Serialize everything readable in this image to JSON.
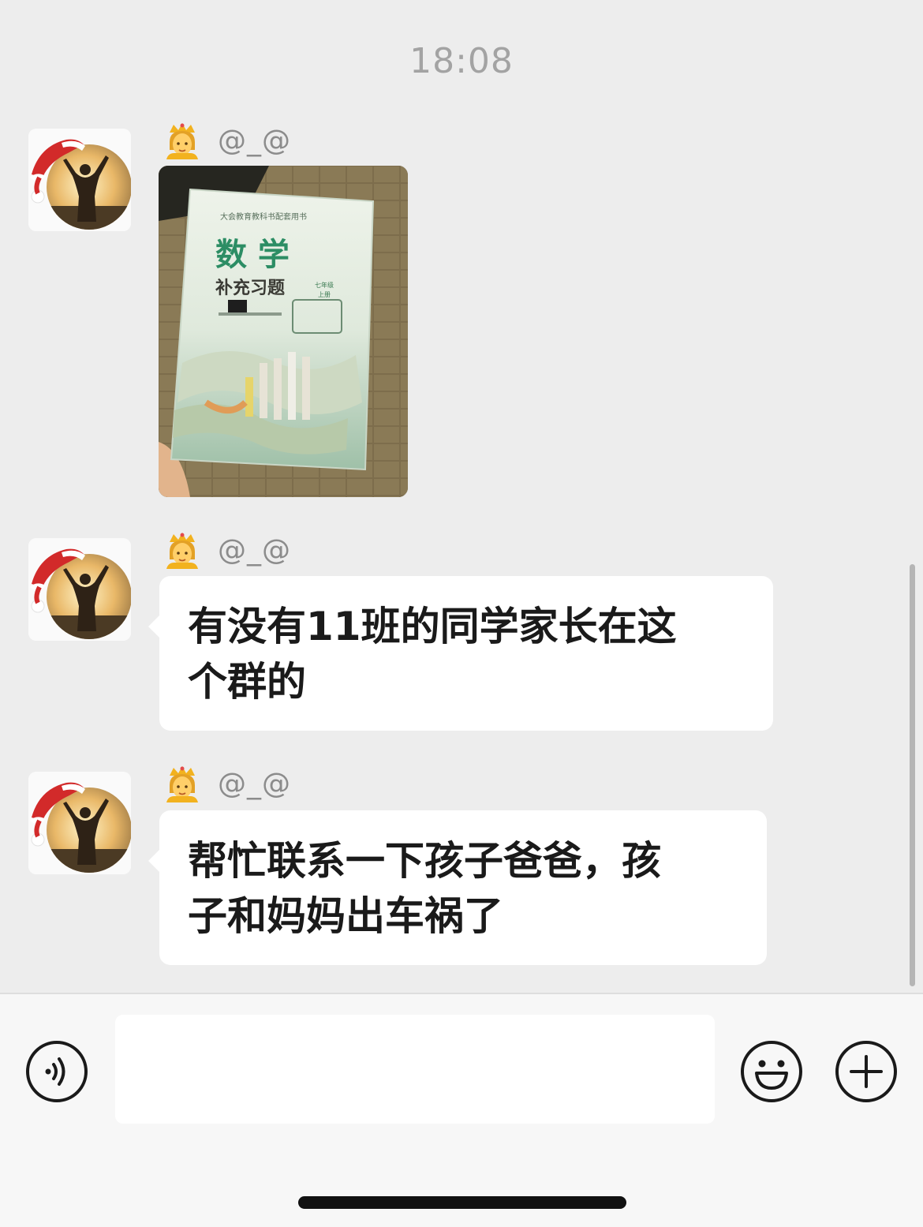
{
  "chat": {
    "timestamp": "18:08",
    "messages": [
      {
        "sender": "@_@",
        "type": "image"
      },
      {
        "sender": "@_@",
        "type": "text",
        "lines": [
          "有没有11班的同学家长在这",
          "个群的"
        ]
      },
      {
        "sender": "@_@",
        "type": "text",
        "lines": [
          "帮忙联系一下孩子爸爸，孩",
          "子和妈妈出车祸了"
        ]
      }
    ]
  },
  "photo": {
    "book_header": "大会教育教科书配套用书",
    "book_title": "数 学",
    "book_subtitle": "补充习题",
    "book_grade": "七年级",
    "book_volume": "上册"
  },
  "input_bar": {
    "placeholder": "",
    "icons": [
      "voice-icon",
      "emoji-icon",
      "plus-icon"
    ]
  },
  "colors": {
    "background": "#ededed",
    "bubble": "#ffffff",
    "sender_name": "#8c8c8c",
    "timestamp": "#a3a3a3"
  }
}
